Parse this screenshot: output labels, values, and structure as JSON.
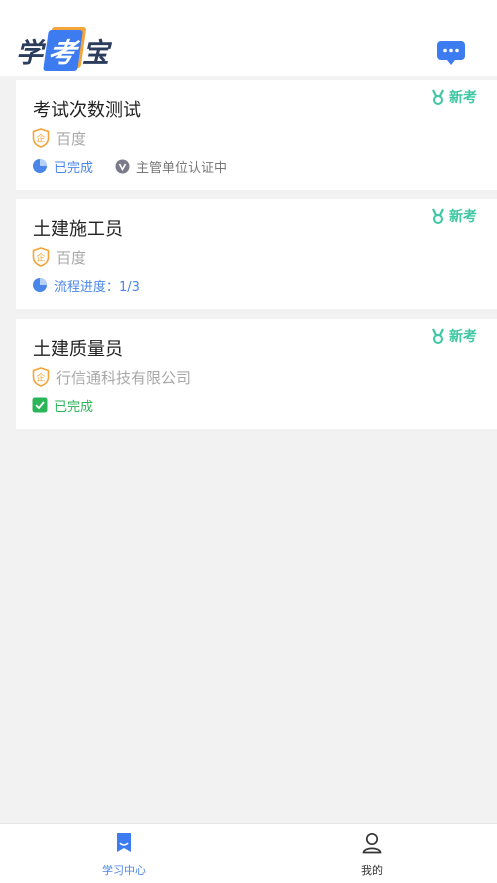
{
  "app": {
    "logo": {
      "part1": "学",
      "part2": "考",
      "part3": "宝"
    }
  },
  "cards": [
    {
      "title": "考试次数测试",
      "company": "百度",
      "badge": "新考",
      "status_text": "已完成",
      "status_type": "progress",
      "extra_text": "主管单位认证中"
    },
    {
      "title": "土建施工员",
      "company": "百度",
      "badge": "新考",
      "status_text": "流程进度：1/3",
      "status_type": "progress"
    },
    {
      "title": "土建质量员",
      "company": "行信通科技有限公司",
      "badge": "新考",
      "status_text": "已完成",
      "status_type": "done"
    }
  ],
  "tabbar": {
    "tabs": [
      {
        "label": "学习中心",
        "active": true,
        "icon": "book-icon"
      },
      {
        "label": "我的",
        "active": false,
        "icon": "user-icon"
      }
    ]
  },
  "colors": {
    "accent": "#4a86e8",
    "done": "#2bb559",
    "badge": "#3dc7a2",
    "shield": "#f3a43a"
  }
}
